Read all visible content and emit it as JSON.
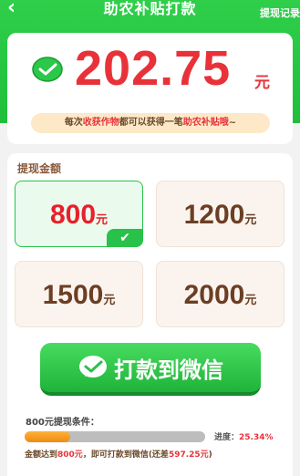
{
  "header": {
    "title": "助农补贴打款",
    "records_link": "提现记录"
  },
  "balance": {
    "amount": "202.75",
    "unit": "元"
  },
  "notice": {
    "prefix": "每次",
    "highlight1": "收获作物",
    "middle": "都可以获得一笔",
    "highlight2": "助农补贴哦",
    "suffix": "~"
  },
  "withdraw": {
    "section_label": "提现金额",
    "unit": "元",
    "options": [
      {
        "amount": "800",
        "selected": true
      },
      {
        "amount": "1200",
        "selected": false
      },
      {
        "amount": "1500",
        "selected": false
      },
      {
        "amount": "2000",
        "selected": false
      }
    ],
    "check_glyph": "✔"
  },
  "pay_button": {
    "label": "打款到微信"
  },
  "condition": {
    "title": "800元提现条件：",
    "progress_text": "进度：",
    "progress_pct": "25.34%",
    "progress_fraction": 0.2534,
    "detail_prefix": "金额达到",
    "detail_amount": "800元",
    "detail_middle": "，即可打款到微信(还差",
    "detail_remaining": "597.25元",
    "detail_suffix": ")"
  },
  "colors": {
    "brand_green": "#28c24a",
    "accent_red": "#e8323a",
    "progress_orange": "#f5a020"
  }
}
